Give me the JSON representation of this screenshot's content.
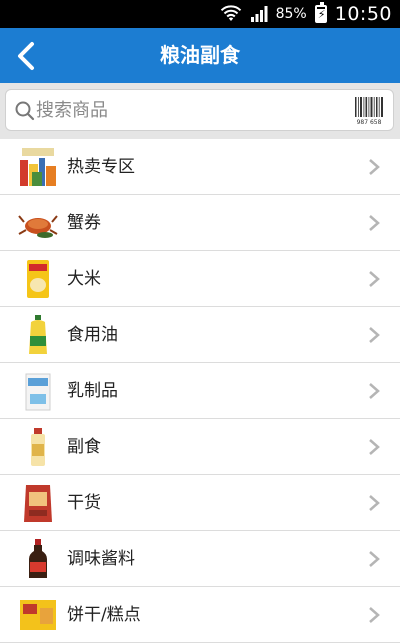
{
  "status_bar": {
    "battery": "85%",
    "time": "10:50"
  },
  "header": {
    "title": "粮油副食"
  },
  "search": {
    "placeholder": "搜索商品",
    "barcode_text": "987 658"
  },
  "categories": [
    {
      "label": "热卖专区"
    },
    {
      "label": "蟹券"
    },
    {
      "label": "大米"
    },
    {
      "label": "食用油"
    },
    {
      "label": "乳制品"
    },
    {
      "label": "副食"
    },
    {
      "label": "干货"
    },
    {
      "label": "调味酱料"
    },
    {
      "label": "饼干/糕点"
    }
  ],
  "colors": {
    "header": "#1c7dd2",
    "chevron": "#b5b5b5",
    "divider": "#dcdcdc"
  }
}
